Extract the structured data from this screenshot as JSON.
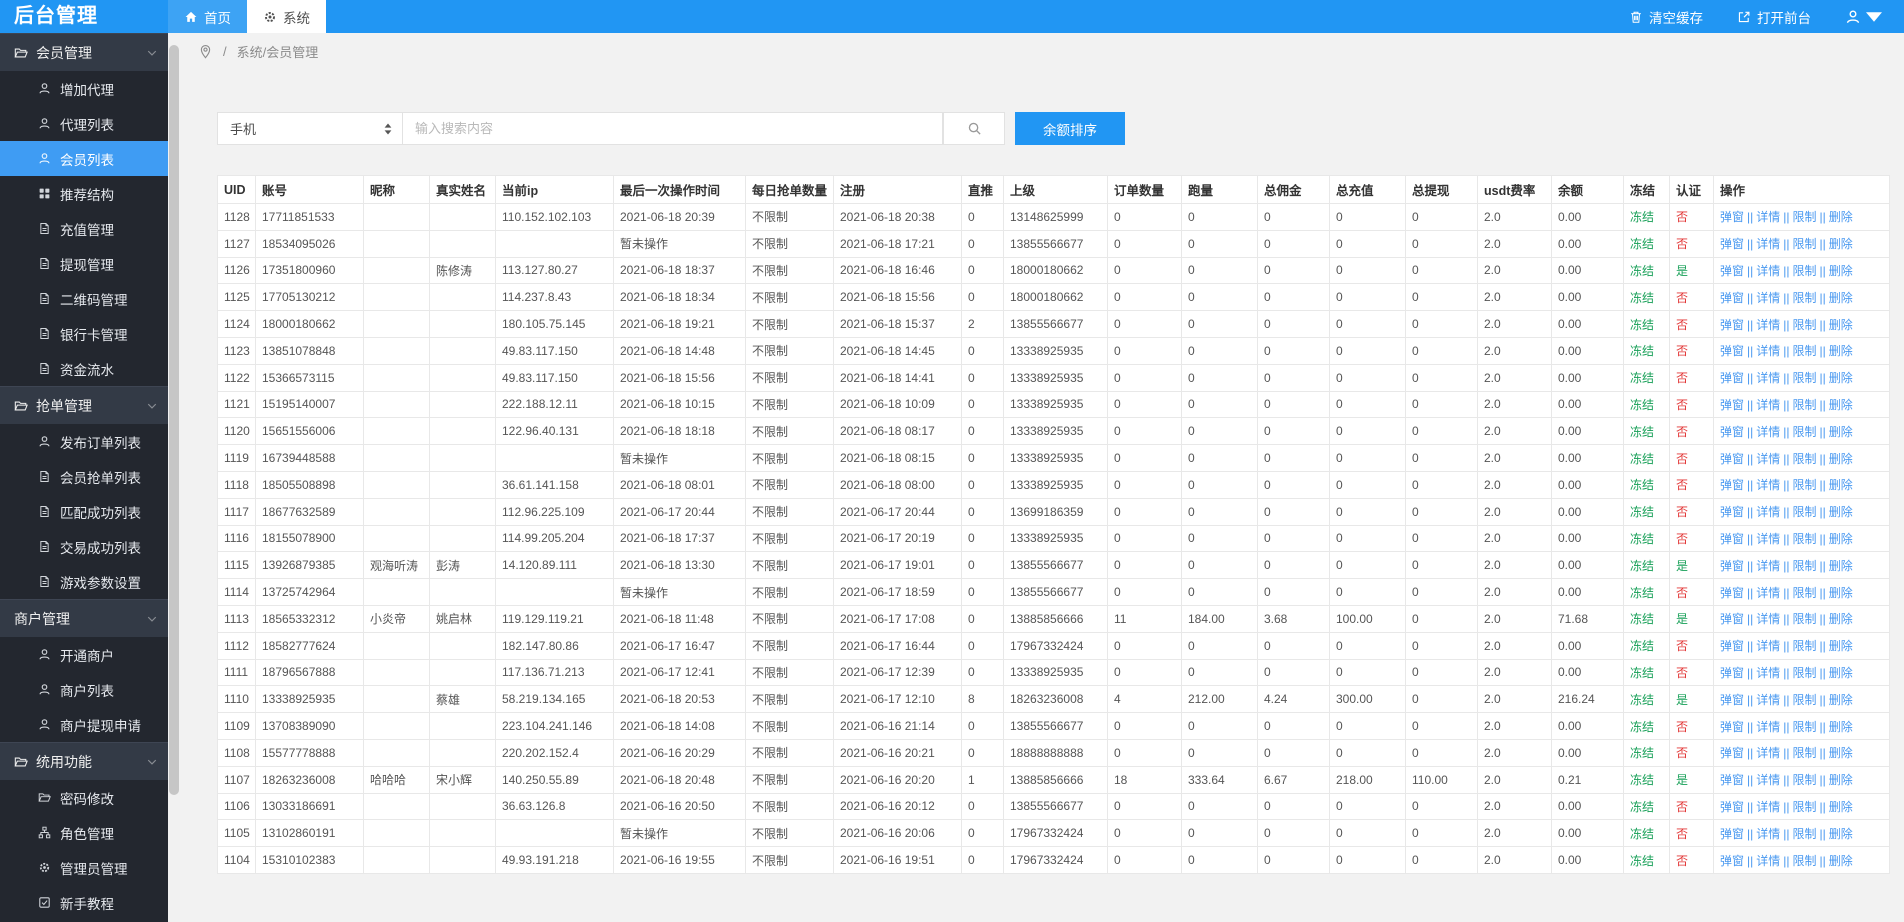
{
  "colors": {
    "accent": "#2196f3",
    "topbar_text": "#ffffff",
    "sidebar_bg": "#23272f",
    "sidebar_group_bg": "#333a46",
    "sidebar_active": "#3f9cf3",
    "link": "#4898f0",
    "green": "#18a058",
    "red": "#e23434",
    "page_bg": "#f2f2f2",
    "border": "#e8e8e8"
  },
  "topbar": {
    "logo": "后台管理",
    "tabs": [
      {
        "label": "首页",
        "icon": "home",
        "active": false
      },
      {
        "label": "系统",
        "icon": "gear",
        "active": true
      }
    ],
    "actions": [
      {
        "label": "清空缓存",
        "icon": "trash"
      },
      {
        "label": "打开前台",
        "icon": "external"
      }
    ]
  },
  "breadcrumb": {
    "separator": "/",
    "path": "系统/会员管理"
  },
  "sidebar": {
    "groups": [
      {
        "label": "会员管理",
        "icon": "folder",
        "items": [
          {
            "label": "增加代理",
            "icon": "user",
            "active": false
          },
          {
            "label": "代理列表",
            "icon": "user",
            "active": false
          },
          {
            "label": "会员列表",
            "icon": "user",
            "active": true
          },
          {
            "label": "推荐结构",
            "icon": "grid",
            "active": false
          },
          {
            "label": "充值管理",
            "icon": "file",
            "active": false
          },
          {
            "label": "提现管理",
            "icon": "file",
            "active": false
          },
          {
            "label": "二维码管理",
            "icon": "file",
            "active": false
          },
          {
            "label": "银行卡管理",
            "icon": "file",
            "active": false
          },
          {
            "label": "资金流水",
            "icon": "file",
            "active": false
          }
        ]
      },
      {
        "label": "抢单管理",
        "icon": "folder",
        "items": [
          {
            "label": "发布订单列表",
            "icon": "user",
            "active": false
          },
          {
            "label": "会员抢单列表",
            "icon": "file",
            "active": false
          },
          {
            "label": "匹配成功列表",
            "icon": "file",
            "active": false
          },
          {
            "label": "交易成功列表",
            "icon": "file",
            "active": false
          },
          {
            "label": "游戏参数设置",
            "icon": "file",
            "active": false
          }
        ]
      },
      {
        "label": "商户管理",
        "icon": null,
        "items": [
          {
            "label": "开通商户",
            "icon": "user",
            "active": false
          },
          {
            "label": "商户列表",
            "icon": "user",
            "active": false
          },
          {
            "label": "商户提现申请",
            "icon": "user",
            "active": false
          }
        ]
      },
      {
        "label": "统用功能",
        "icon": "folder",
        "items": [
          {
            "label": "密码修改",
            "icon": "folder",
            "active": false
          },
          {
            "label": "角色管理",
            "icon": "sitemap",
            "active": false
          },
          {
            "label": "管理员管理",
            "icon": "gear",
            "active": false
          },
          {
            "label": "新手教程",
            "icon": "book",
            "active": false
          }
        ]
      }
    ]
  },
  "toolbar": {
    "field": "手机",
    "placeholder": "输入搜索内容",
    "sort_button": "余额排序"
  },
  "table": {
    "columns": [
      "UID",
      "账号",
      "昵称",
      "真实姓名",
      "当前ip",
      "最后一次操作时间",
      "每日抢单数量",
      "注册",
      "直推",
      "上级",
      "订单数量",
      "跑量",
      "总佣金",
      "总充值",
      "总提现",
      "usdt费率",
      "余额",
      "冻结",
      "认证",
      "操作"
    ],
    "actions": [
      "弹窗",
      "详情",
      "限制",
      "删除"
    ],
    "action_separator": "||",
    "rows": [
      {
        "uid": "1128",
        "account": "17711851533",
        "nickname": "",
        "realname": "",
        "ip": "110.152.102.103",
        "last_op": "2021-06-18 20:39",
        "daily_limit": "不限制",
        "registered": "2021-06-18 20:38",
        "direct": "0",
        "upline": "13148625999",
        "orders": "0",
        "volume": "0",
        "commission": "0",
        "recharge": "0",
        "withdraw": "0",
        "usdt_rate": "2.0",
        "balance": "0.00",
        "freeze": "冻结",
        "verified": "否"
      },
      {
        "uid": "1127",
        "account": "18534095026",
        "nickname": "",
        "realname": "",
        "ip": "",
        "last_op": "暂未操作",
        "daily_limit": "不限制",
        "registered": "2021-06-18 17:21",
        "direct": "0",
        "upline": "13855566677",
        "orders": "0",
        "volume": "0",
        "commission": "0",
        "recharge": "0",
        "withdraw": "0",
        "usdt_rate": "2.0",
        "balance": "0.00",
        "freeze": "冻结",
        "verified": "否"
      },
      {
        "uid": "1126",
        "account": "17351800960",
        "nickname": "",
        "realname": "陈修涛",
        "ip": "113.127.80.27",
        "last_op": "2021-06-18 18:37",
        "daily_limit": "不限制",
        "registered": "2021-06-18 16:46",
        "direct": "0",
        "upline": "18000180662",
        "orders": "0",
        "volume": "0",
        "commission": "0",
        "recharge": "0",
        "withdraw": "0",
        "usdt_rate": "2.0",
        "balance": "0.00",
        "freeze": "冻结",
        "verified": "是"
      },
      {
        "uid": "1125",
        "account": "17705130212",
        "nickname": "",
        "realname": "",
        "ip": "114.237.8.43",
        "last_op": "2021-06-18 18:34",
        "daily_limit": "不限制",
        "registered": "2021-06-18 15:56",
        "direct": "0",
        "upline": "18000180662",
        "orders": "0",
        "volume": "0",
        "commission": "0",
        "recharge": "0",
        "withdraw": "0",
        "usdt_rate": "2.0",
        "balance": "0.00",
        "freeze": "冻结",
        "verified": "否"
      },
      {
        "uid": "1124",
        "account": "18000180662",
        "nickname": "",
        "realname": "",
        "ip": "180.105.75.145",
        "last_op": "2021-06-18 19:21",
        "daily_limit": "不限制",
        "registered": "2021-06-18 15:37",
        "direct": "2",
        "upline": "13855566677",
        "orders": "0",
        "volume": "0",
        "commission": "0",
        "recharge": "0",
        "withdraw": "0",
        "usdt_rate": "2.0",
        "balance": "0.00",
        "freeze": "冻结",
        "verified": "否"
      },
      {
        "uid": "1123",
        "account": "13851078848",
        "nickname": "",
        "realname": "",
        "ip": "49.83.117.150",
        "last_op": "2021-06-18 14:48",
        "daily_limit": "不限制",
        "registered": "2021-06-18 14:45",
        "direct": "0",
        "upline": "13338925935",
        "orders": "0",
        "volume": "0",
        "commission": "0",
        "recharge": "0",
        "withdraw": "0",
        "usdt_rate": "2.0",
        "balance": "0.00",
        "freeze": "冻结",
        "verified": "否"
      },
      {
        "uid": "1122",
        "account": "15366573115",
        "nickname": "",
        "realname": "",
        "ip": "49.83.117.150",
        "last_op": "2021-06-18 15:56",
        "daily_limit": "不限制",
        "registered": "2021-06-18 14:41",
        "direct": "0",
        "upline": "13338925935",
        "orders": "0",
        "volume": "0",
        "commission": "0",
        "recharge": "0",
        "withdraw": "0",
        "usdt_rate": "2.0",
        "balance": "0.00",
        "freeze": "冻结",
        "verified": "否"
      },
      {
        "uid": "1121",
        "account": "15195140007",
        "nickname": "",
        "realname": "",
        "ip": "222.188.12.11",
        "last_op": "2021-06-18 10:15",
        "daily_limit": "不限制",
        "registered": "2021-06-18 10:09",
        "direct": "0",
        "upline": "13338925935",
        "orders": "0",
        "volume": "0",
        "commission": "0",
        "recharge": "0",
        "withdraw": "0",
        "usdt_rate": "2.0",
        "balance": "0.00",
        "freeze": "冻结",
        "verified": "否"
      },
      {
        "uid": "1120",
        "account": "15651556006",
        "nickname": "",
        "realname": "",
        "ip": "122.96.40.131",
        "last_op": "2021-06-18 18:18",
        "daily_limit": "不限制",
        "registered": "2021-06-18 08:17",
        "direct": "0",
        "upline": "13338925935",
        "orders": "0",
        "volume": "0",
        "commission": "0",
        "recharge": "0",
        "withdraw": "0",
        "usdt_rate": "2.0",
        "balance": "0.00",
        "freeze": "冻结",
        "verified": "否"
      },
      {
        "uid": "1119",
        "account": "16739448588",
        "nickname": "",
        "realname": "",
        "ip": "",
        "last_op": "暂未操作",
        "daily_limit": "不限制",
        "registered": "2021-06-18 08:15",
        "direct": "0",
        "upline": "13338925935",
        "orders": "0",
        "volume": "0",
        "commission": "0",
        "recharge": "0",
        "withdraw": "0",
        "usdt_rate": "2.0",
        "balance": "0.00",
        "freeze": "冻结",
        "verified": "否"
      },
      {
        "uid": "1118",
        "account": "18505508898",
        "nickname": "",
        "realname": "",
        "ip": "36.61.141.158",
        "last_op": "2021-06-18 08:01",
        "daily_limit": "不限制",
        "registered": "2021-06-18 08:00",
        "direct": "0",
        "upline": "13338925935",
        "orders": "0",
        "volume": "0",
        "commission": "0",
        "recharge": "0",
        "withdraw": "0",
        "usdt_rate": "2.0",
        "balance": "0.00",
        "freeze": "冻结",
        "verified": "否"
      },
      {
        "uid": "1117",
        "account": "18677632589",
        "nickname": "",
        "realname": "",
        "ip": "112.96.225.109",
        "last_op": "2021-06-17 20:44",
        "daily_limit": "不限制",
        "registered": "2021-06-17 20:44",
        "direct": "0",
        "upline": "13699186359",
        "orders": "0",
        "volume": "0",
        "commission": "0",
        "recharge": "0",
        "withdraw": "0",
        "usdt_rate": "2.0",
        "balance": "0.00",
        "freeze": "冻结",
        "verified": "否"
      },
      {
        "uid": "1116",
        "account": "18155078900",
        "nickname": "",
        "realname": "",
        "ip": "114.99.205.204",
        "last_op": "2021-06-18 17:37",
        "daily_limit": "不限制",
        "registered": "2021-06-17 20:19",
        "direct": "0",
        "upline": "13338925935",
        "orders": "0",
        "volume": "0",
        "commission": "0",
        "recharge": "0",
        "withdraw": "0",
        "usdt_rate": "2.0",
        "balance": "0.00",
        "freeze": "冻结",
        "verified": "否"
      },
      {
        "uid": "1115",
        "account": "13926879385",
        "nickname": "观海听涛",
        "realname": "彭涛",
        "ip": "14.120.89.111",
        "last_op": "2021-06-18 13:30",
        "daily_limit": "不限制",
        "registered": "2021-06-17 19:01",
        "direct": "0",
        "upline": "13855566677",
        "orders": "0",
        "volume": "0",
        "commission": "0",
        "recharge": "0",
        "withdraw": "0",
        "usdt_rate": "2.0",
        "balance": "0.00",
        "freeze": "冻结",
        "verified": "是"
      },
      {
        "uid": "1114",
        "account": "13725742964",
        "nickname": "",
        "realname": "",
        "ip": "",
        "last_op": "暂未操作",
        "daily_limit": "不限制",
        "registered": "2021-06-17 18:59",
        "direct": "0",
        "upline": "13855566677",
        "orders": "0",
        "volume": "0",
        "commission": "0",
        "recharge": "0",
        "withdraw": "0",
        "usdt_rate": "2.0",
        "balance": "0.00",
        "freeze": "冻结",
        "verified": "否"
      },
      {
        "uid": "1113",
        "account": "18565332312",
        "nickname": "小炎帝",
        "realname": "姚启林",
        "ip": "119.129.119.21",
        "last_op": "2021-06-18 11:48",
        "daily_limit": "不限制",
        "registered": "2021-06-17 17:08",
        "direct": "0",
        "upline": "13885856666",
        "orders": "11",
        "volume": "184.00",
        "commission": "3.68",
        "recharge": "100.00",
        "withdraw": "0",
        "usdt_rate": "2.0",
        "balance": "71.68",
        "freeze": "冻结",
        "verified": "是"
      },
      {
        "uid": "1112",
        "account": "18582777624",
        "nickname": "",
        "realname": "",
        "ip": "182.147.80.86",
        "last_op": "2021-06-17 16:47",
        "daily_limit": "不限制",
        "registered": "2021-06-17 16:44",
        "direct": "0",
        "upline": "17967332424",
        "orders": "0",
        "volume": "0",
        "commission": "0",
        "recharge": "0",
        "withdraw": "0",
        "usdt_rate": "2.0",
        "balance": "0.00",
        "freeze": "冻结",
        "verified": "否"
      },
      {
        "uid": "1111",
        "account": "18796567888",
        "nickname": "",
        "realname": "",
        "ip": "117.136.71.213",
        "last_op": "2021-06-17 12:41",
        "daily_limit": "不限制",
        "registered": "2021-06-17 12:39",
        "direct": "0",
        "upline": "13338925935",
        "orders": "0",
        "volume": "0",
        "commission": "0",
        "recharge": "0",
        "withdraw": "0",
        "usdt_rate": "2.0",
        "balance": "0.00",
        "freeze": "冻结",
        "verified": "否"
      },
      {
        "uid": "1110",
        "account": "13338925935",
        "nickname": "",
        "realname": "蔡雄",
        "ip": "58.219.134.165",
        "last_op": "2021-06-18 20:53",
        "daily_limit": "不限制",
        "registered": "2021-06-17 12:10",
        "direct": "8",
        "upline": "18263236008",
        "orders": "4",
        "volume": "212.00",
        "commission": "4.24",
        "recharge": "300.00",
        "withdraw": "0",
        "usdt_rate": "2.0",
        "balance": "216.24",
        "freeze": "冻结",
        "verified": "是"
      },
      {
        "uid": "1109",
        "account": "13708389090",
        "nickname": "",
        "realname": "",
        "ip": "223.104.241.146",
        "last_op": "2021-06-18 14:08",
        "daily_limit": "不限制",
        "registered": "2021-06-16 21:14",
        "direct": "0",
        "upline": "13855566677",
        "orders": "0",
        "volume": "0",
        "commission": "0",
        "recharge": "0",
        "withdraw": "0",
        "usdt_rate": "2.0",
        "balance": "0.00",
        "freeze": "冻结",
        "verified": "否"
      },
      {
        "uid": "1108",
        "account": "15577778888",
        "nickname": "",
        "realname": "",
        "ip": "220.202.152.4",
        "last_op": "2021-06-16 20:29",
        "daily_limit": "不限制",
        "registered": "2021-06-16 20:21",
        "direct": "0",
        "upline": "18888888888",
        "orders": "0",
        "volume": "0",
        "commission": "0",
        "recharge": "0",
        "withdraw": "0",
        "usdt_rate": "2.0",
        "balance": "0.00",
        "freeze": "冻结",
        "verified": "否"
      },
      {
        "uid": "1107",
        "account": "18263236008",
        "nickname": "哈哈哈",
        "realname": "宋小辉",
        "ip": "140.250.55.89",
        "last_op": "2021-06-18 20:48",
        "daily_limit": "不限制",
        "registered": "2021-06-16 20:20",
        "direct": "1",
        "upline": "13885856666",
        "orders": "18",
        "volume": "333.64",
        "commission": "6.67",
        "recharge": "218.00",
        "withdraw": "110.00",
        "usdt_rate": "2.0",
        "balance": "0.21",
        "freeze": "冻结",
        "verified": "是"
      },
      {
        "uid": "1106",
        "account": "13033186691",
        "nickname": "",
        "realname": "",
        "ip": "36.63.126.8",
        "last_op": "2021-06-16 20:50",
        "daily_limit": "不限制",
        "registered": "2021-06-16 20:12",
        "direct": "0",
        "upline": "13855566677",
        "orders": "0",
        "volume": "0",
        "commission": "0",
        "recharge": "0",
        "withdraw": "0",
        "usdt_rate": "2.0",
        "balance": "0.00",
        "freeze": "冻结",
        "verified": "否"
      },
      {
        "uid": "1105",
        "account": "13102860191",
        "nickname": "",
        "realname": "",
        "ip": "",
        "last_op": "暂未操作",
        "daily_limit": "不限制",
        "registered": "2021-06-16 20:06",
        "direct": "0",
        "upline": "17967332424",
        "orders": "0",
        "volume": "0",
        "commission": "0",
        "recharge": "0",
        "withdraw": "0",
        "usdt_rate": "2.0",
        "balance": "0.00",
        "freeze": "冻结",
        "verified": "否"
      },
      {
        "uid": "1104",
        "account": "15310102383",
        "nickname": "",
        "realname": "",
        "ip": "49.93.191.218",
        "last_op": "2021-06-16 19:55",
        "daily_limit": "不限制",
        "registered": "2021-06-16 19:51",
        "direct": "0",
        "upline": "17967332424",
        "orders": "0",
        "volume": "0",
        "commission": "0",
        "recharge": "0",
        "withdraw": "0",
        "usdt_rate": "2.0",
        "balance": "0.00",
        "freeze": "冻结",
        "verified": "否"
      }
    ]
  }
}
